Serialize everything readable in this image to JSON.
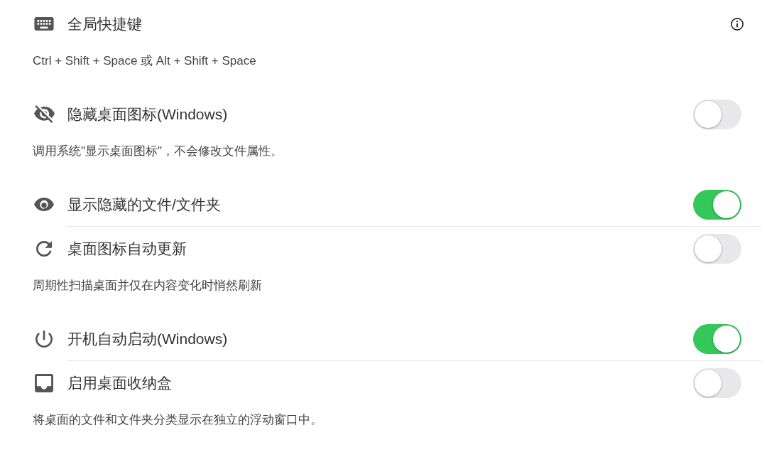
{
  "settings": [
    {
      "kind": "info",
      "title": "全局快捷键",
      "description": "Ctrl + Shift + Space 或 Alt + Shift + Space"
    },
    {
      "kind": "toggle",
      "title": "隐藏桌面图标(Windows)",
      "on": false,
      "description": "调用系统\"显示桌面图标\"，不会修改文件属性。"
    },
    {
      "kind": "toggle",
      "title": "显示隐藏的文件/文件夹",
      "on": true
    },
    {
      "kind": "toggle",
      "title": "桌面图标自动更新",
      "on": false,
      "description": "周期性扫描桌面并仅在内容变化时悄然刷新"
    },
    {
      "kind": "toggle",
      "title": "开机自动启动(Windows)",
      "on": true
    },
    {
      "kind": "toggle",
      "title": "启用桌面收纳盒",
      "on": false,
      "description": "将桌面的文件和文件夹分类显示在独立的浮动窗口中。"
    }
  ]
}
